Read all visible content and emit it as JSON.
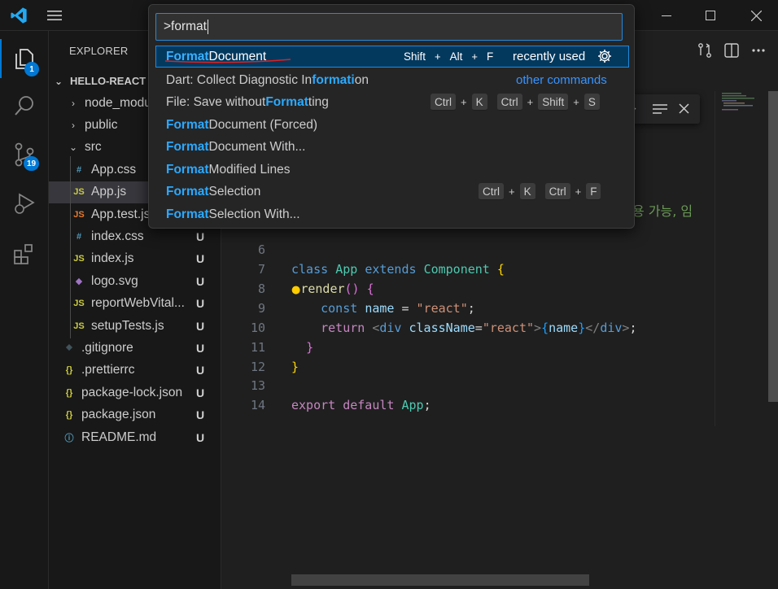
{
  "palette": {
    "query": ">format",
    "items": [
      {
        "match": "Format",
        "rest": " Document",
        "keys": [
          "Shift",
          "Alt",
          "F"
        ],
        "note": "recently used",
        "note_icon": "gear-icon"
      },
      {
        "pre": "Dart: Collect Diagnostic In",
        "match": "formati",
        "rest": "on",
        "note": "other commands"
      },
      {
        "pre": "File: Save without ",
        "match": "Format",
        "rest": "ting",
        "chord1": [
          "Ctrl",
          "K"
        ],
        "chord2": [
          "Ctrl",
          "Shift",
          "S"
        ]
      },
      {
        "match": "Format",
        "rest": " Document (Forced)"
      },
      {
        "match": "Format",
        "rest": " Document With..."
      },
      {
        "match": "Format",
        "rest": " Modified Lines"
      },
      {
        "match": "Format",
        "rest": " Selection",
        "chord1": [
          "Ctrl",
          "K"
        ],
        "chord2": [
          "Ctrl",
          "F"
        ]
      },
      {
        "match": "Format",
        "rest": " Selection With..."
      }
    ]
  },
  "activity_bar": {
    "explorer_badge": "1",
    "scm_badge": "19"
  },
  "explorer": {
    "title": "EXPLORER",
    "root": "HELLO-REACT",
    "rows": [
      {
        "label": "node_modules",
        "chev": "›",
        "icon": "",
        "status": ""
      },
      {
        "label": "public",
        "chev": "›",
        "icon": "",
        "status": ""
      },
      {
        "label": "src",
        "chev": "⌄",
        "icon": "",
        "status": ""
      },
      {
        "label": "App.css",
        "icon": "#",
        "icon_color": "#519aba",
        "status": ""
      },
      {
        "label": "App.js",
        "icon": "JS",
        "icon_color": "#cbcb41",
        "status": ""
      },
      {
        "label": "App.test.js",
        "icon": "JS",
        "icon_color": "#e37933",
        "status": ""
      },
      {
        "label": "index.css",
        "icon": "#",
        "icon_color": "#519aba",
        "status": "U"
      },
      {
        "label": "index.js",
        "icon": "JS",
        "icon_color": "#cbcb41",
        "status": "U"
      },
      {
        "label": "logo.svg",
        "icon": "◆",
        "icon_color": "#a074c4",
        "status": "U"
      },
      {
        "label": "reportWebVital...",
        "icon": "JS",
        "icon_color": "#cbcb41",
        "status": "U"
      },
      {
        "label": "setupTests.js",
        "icon": "JS",
        "icon_color": "#cbcb41",
        "status": "U"
      },
      {
        "label": ".gitignore",
        "icon": "⬥",
        "icon_color": "#41535b",
        "status": "U"
      },
      {
        "label": ".prettierrc",
        "icon": "{}",
        "icon_color": "#cbcb41",
        "status": "U"
      },
      {
        "label": "package-lock.json",
        "icon": "{}",
        "icon_color": "#cbcb41",
        "status": "U"
      },
      {
        "label": "package.json",
        "icon": "{}",
        "icon_color": "#cbcb41",
        "status": "U"
      },
      {
        "label": "README.md",
        "icon": "ⓘ",
        "icon_color": "#519aba",
        "status": "U"
      }
    ]
  },
  "editor": {
    "overflow_comment": "용 가능, 임",
    "line_numbers": [
      "6",
      "7",
      "8",
      "9",
      "10",
      "11",
      "12",
      "13",
      "14"
    ]
  }
}
